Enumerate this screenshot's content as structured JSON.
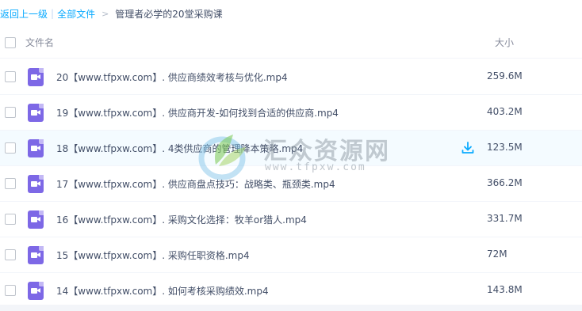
{
  "breadcrumb": {
    "back": "返回上一级",
    "separator": "|",
    "all_files": "全部文件",
    "arrow": ">",
    "current": "管理者必学的20堂采购课"
  },
  "header": {
    "name_label": "文件名",
    "size_label": "大小"
  },
  "files": [
    {
      "name": "20【www.tfpxw.com】. 供应商绩效考核与优化.mp4",
      "size": "259.6M",
      "icon": "video-file-icon"
    },
    {
      "name": "19【www.tfpxw.com】. 供应商开发-如何找到合适的供应商.mp4",
      "size": "403.2M",
      "icon": "video-file-icon"
    },
    {
      "name": "18【www.tfpxw.com】. 4类供应商的管理降本策略.mp4",
      "size": "123.5M",
      "icon": "video-file-icon",
      "hovered": true
    },
    {
      "name": "17【www.tfpxw.com】. 供应商盘点技巧：战略类、瓶颈类.mp4",
      "size": "366.2M",
      "icon": "video-file-icon"
    },
    {
      "name": "16【www.tfpxw.com】. 采购文化选择：牧羊or猎人.mp4",
      "size": "331.7M",
      "icon": "video-file-icon"
    },
    {
      "name": "15【www.tfpxw.com】. 采购任职资格.mp4",
      "size": "72M",
      "icon": "video-file-icon"
    },
    {
      "name": "14【www.tfpxw.com】. 如何考核采购绩效.mp4",
      "size": "143.8M",
      "icon": "video-file-icon"
    }
  ],
  "watermark": {
    "title": "汇众资源网",
    "url": "www.tfpxw.com"
  },
  "colors": {
    "link": "#09aaff",
    "text": "#424e67",
    "video_icon": "#7d68e6",
    "hover_row": "#f4fbff",
    "download_icon": "#09aaff"
  }
}
